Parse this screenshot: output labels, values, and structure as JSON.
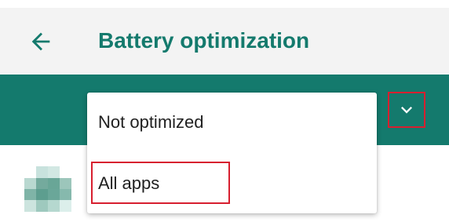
{
  "screen": {
    "title": "Battery optimization",
    "colors": {
      "accent": "#147a6d",
      "highlight": "#d71f2f",
      "background": "#fafafa"
    }
  },
  "header": {
    "back_icon": "arrow-left-icon",
    "title": "Battery optimization",
    "dropdown_icon": "chevron-down-icon"
  },
  "dropdown_menu": {
    "items": [
      {
        "label": "Not optimized"
      },
      {
        "label": "All apps"
      }
    ]
  },
  "app_list": {
    "item_icon": "pixelated-app-icon"
  }
}
